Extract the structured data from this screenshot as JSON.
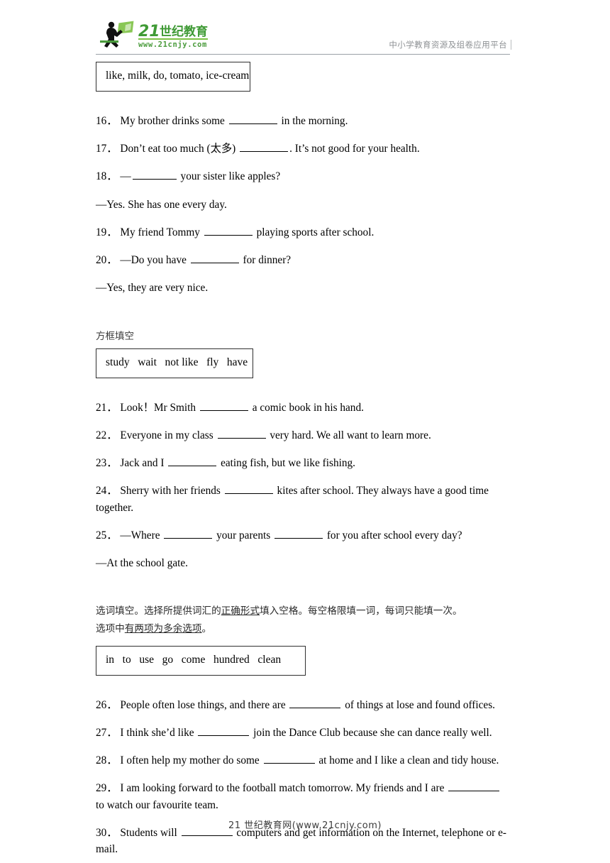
{
  "header": {
    "logo_main": "21世纪教育",
    "logo_url": "www.21cnjy.com",
    "logo_icon": "running-person-icon",
    "tagline": "中小学教育资源及组卷应用平台",
    "brand_green": "#4a9b3c",
    "brand_dark_green": "#2e7d32",
    "tagline_color": "#8e9194"
  },
  "section1": {
    "wordbox": "like, milk, do, tomato, ice-cream",
    "questions": [
      {
        "num": "16．",
        "parts": [
          {
            "t": "text",
            "v": "My brother drinks some "
          },
          {
            "t": "blank",
            "w": "w2"
          },
          {
            "t": "text",
            "v": " in the morning."
          }
        ]
      },
      {
        "num": "17．",
        "parts": [
          {
            "t": "text",
            "v": "Don’t eat too much (太多) "
          },
          {
            "t": "blank",
            "w": "w2"
          },
          {
            "t": "text",
            "v": ". It’s not good for your health."
          }
        ]
      },
      {
        "num": "18．",
        "parts": [
          {
            "t": "text",
            "v": "—"
          },
          {
            "t": "blank",
            "w": "w1"
          },
          {
            "t": "text",
            "v": " your sister like apples?"
          }
        ]
      },
      {
        "num": "",
        "parts": [
          {
            "t": "text",
            "v": "—Yes. She has one every day."
          }
        ]
      },
      {
        "num": "19．",
        "parts": [
          {
            "t": "text",
            "v": "My friend Tommy "
          },
          {
            "t": "blank",
            "w": "w2"
          },
          {
            "t": "text",
            "v": " playing sports after school."
          }
        ]
      },
      {
        "num": "20．",
        "parts": [
          {
            "t": "text",
            "v": "—Do you have "
          },
          {
            "t": "blank",
            "w": "w2"
          },
          {
            "t": "text",
            "v": " for dinner?"
          }
        ]
      },
      {
        "num": "",
        "parts": [
          {
            "t": "text",
            "v": "—Yes, they are very nice."
          }
        ]
      }
    ]
  },
  "section2": {
    "label": "方框填空",
    "wordbox": "study   wait   not like   fly   have",
    "questions": [
      {
        "num": "21．",
        "parts": [
          {
            "t": "text",
            "v": "Look！Mr Smith "
          },
          {
            "t": "blank",
            "w": "w2"
          },
          {
            "t": "text",
            "v": " a comic book in his hand."
          }
        ]
      },
      {
        "num": "22．",
        "parts": [
          {
            "t": "text",
            "v": "Everyone in my class "
          },
          {
            "t": "blank",
            "w": "w2"
          },
          {
            "t": "text",
            "v": " very hard. We all want to learn more."
          }
        ]
      },
      {
        "num": "23．",
        "parts": [
          {
            "t": "text",
            "v": "Jack and I "
          },
          {
            "t": "blank",
            "w": "w2"
          },
          {
            "t": "text",
            "v": " eating fish, but we like fishing."
          }
        ]
      },
      {
        "num": "24．",
        "parts": [
          {
            "t": "text",
            "v": "Sherry with her friends "
          },
          {
            "t": "blank",
            "w": "w2"
          },
          {
            "t": "text",
            "v": " kites after school. They always have a good time together."
          }
        ]
      },
      {
        "num": "25．",
        "parts": [
          {
            "t": "text",
            "v": "—Where "
          },
          {
            "t": "blank",
            "w": "w2"
          },
          {
            "t": "text",
            "v": " your parents "
          },
          {
            "t": "blank",
            "w": "w2"
          },
          {
            "t": "text",
            "v": " for you after school every day?"
          }
        ]
      },
      {
        "num": "",
        "parts": [
          {
            "t": "text",
            "v": "—At the school gate."
          }
        ]
      }
    ]
  },
  "section3": {
    "instruction_line1_a": "选词填空。选择所提供词汇的",
    "instruction_line1_u": "正确形式",
    "instruction_line1_b": "填入空格。每空格限填一词，每词只能填一次。",
    "instruction_line2_a": "选项中",
    "instruction_line2_u": "有两项为多余选项",
    "instruction_line2_b": "。",
    "wordbox": "in   to   use   go   come   hundred   clean",
    "questions": [
      {
        "num": "26．",
        "parts": [
          {
            "t": "text",
            "v": "People often lose things, and there are "
          },
          {
            "t": "blank",
            "w": "w3"
          },
          {
            "t": "text",
            "v": " of things at lose and found offices."
          }
        ]
      },
      {
        "num": "27．",
        "parts": [
          {
            "t": "text",
            "v": "I think she’d like "
          },
          {
            "t": "blank",
            "w": "w3"
          },
          {
            "t": "text",
            "v": " join the Dance Club because she can dance really well."
          }
        ]
      },
      {
        "num": "28．",
        "parts": [
          {
            "t": "text",
            "v": "I often help my mother do some "
          },
          {
            "t": "blank",
            "w": "w3"
          },
          {
            "t": "text",
            "v": " at home and I like a clean and tidy house."
          }
        ]
      },
      {
        "num": "29．",
        "parts": [
          {
            "t": "text",
            "v": "I am looking forward to the football match tomorrow. My friends and I are "
          },
          {
            "t": "blank",
            "w": "w3"
          },
          {
            "t": "text",
            "v": " to watch our favourite team."
          }
        ]
      },
      {
        "num": "30．",
        "parts": [
          {
            "t": "text",
            "v": "Students will "
          },
          {
            "t": "blank",
            "w": "w3"
          },
          {
            "t": "text",
            "v": " computers and get information on the Internet, telephone or e-mail."
          }
        ]
      }
    ]
  },
  "footer": {
    "text": "21 世纪教育网(www.21cnjy.com)"
  }
}
